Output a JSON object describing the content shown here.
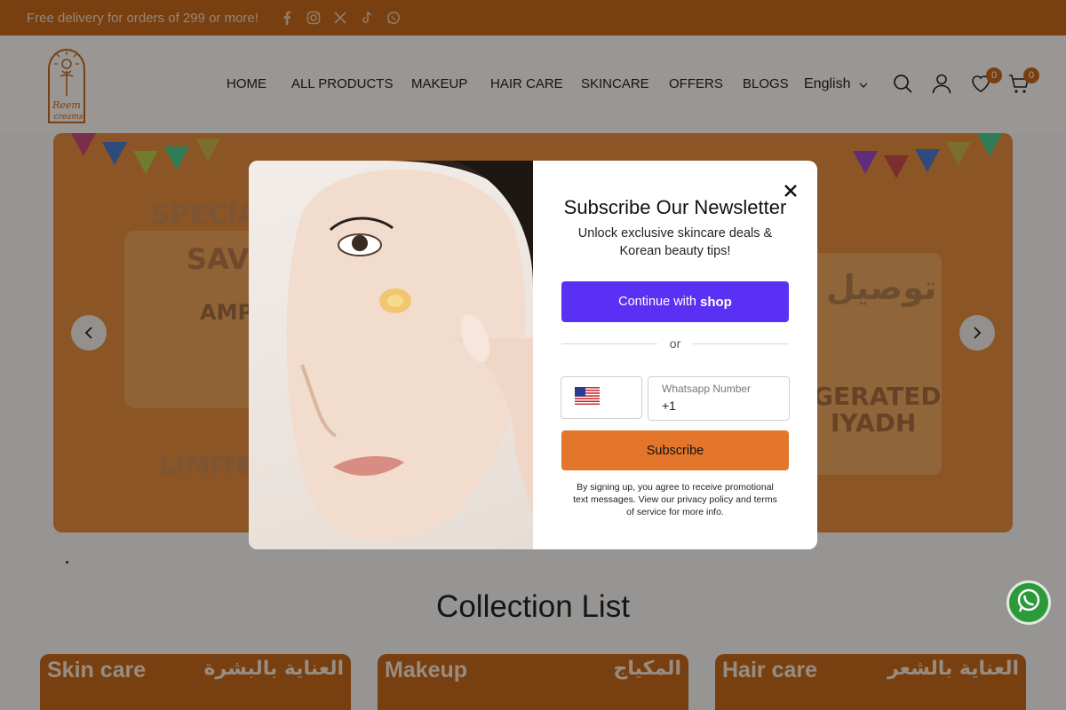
{
  "topbar": {
    "promo": "Free delivery for orders of 299 or more!",
    "socials": [
      "facebook-icon",
      "instagram-icon",
      "x-icon",
      "tiktok-icon",
      "whatsapp-icon"
    ]
  },
  "header": {
    "logo_text": "Reem creams",
    "nav": [
      "HOME",
      "ALL PRODUCTS",
      "MAKEUP",
      "HAIR CARE",
      "SKINCARE",
      "OFFERS",
      "BLOGS"
    ],
    "language": "English",
    "wishlist_count": "0",
    "cart_count": "0"
  },
  "hero": {
    "left_text_1": "SPECIA",
    "left_text_2": "SAV",
    "left_text_3": "AMPO",
    "left_text_4": "LIMITE",
    "right_text_1": "توصيل",
    "right_text_2": "GERATED",
    "right_text_3": "IYADH"
  },
  "modal": {
    "title": "Subscribe Our Newsletter",
    "subtitle": "Unlock exclusive skincare deals & Korean beauty tips!",
    "shop_button_prefix": "Continue with",
    "shop_button_brand": "shop",
    "divider": "or",
    "phone_label": "Whatsapp Number",
    "phone_value": "+1",
    "subscribe_button": "Subscribe",
    "legal": "By signing up, you agree to receive promotional text messages. View our privacy policy and terms of service for more info."
  },
  "collection": {
    "title": "Collection List",
    "cards": [
      {
        "en": "Skin care",
        "ar": "العناية بالبشرة"
      },
      {
        "en": "Makeup",
        "ar": "المكياج"
      },
      {
        "en": "Hair care",
        "ar": "العناية بالشعر"
      }
    ]
  },
  "colors": {
    "brand": "#c2661b",
    "shop_purple": "#5a31f4",
    "subscribe_orange": "#e3762a"
  }
}
